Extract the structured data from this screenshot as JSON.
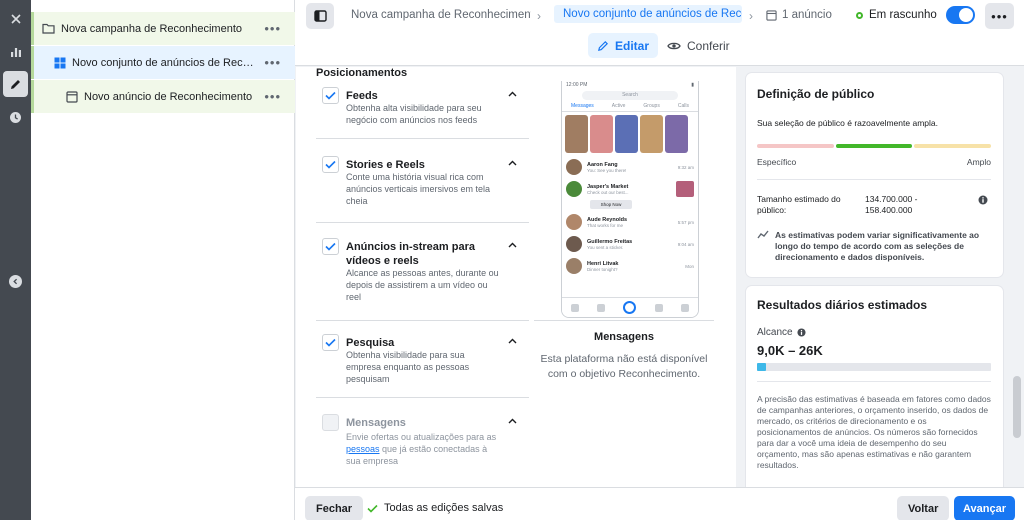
{
  "tree": {
    "campaign": "Nova campanha de Reconhecimento",
    "adset": "Novo conjunto de anúncios de Reconhecimento",
    "ad": "Novo anúncio de Reconhecimento",
    "more": "•••"
  },
  "topbar": {
    "crumb_campaign": "Nova campanha de Reconhecimento",
    "crumb_adset": "Novo conjunto de anúncios de Reconhecimento",
    "crumb_ad": "1 anúncio",
    "status": "Em rascunho",
    "more": "•••",
    "mode_edit": "Editar",
    "mode_review": "Conferir"
  },
  "placements": {
    "title": "Posicionamentos",
    "items": [
      {
        "name": "Feeds",
        "desc": "Obtenha alta visibilidade para seu negócio com anúncios nos feeds"
      },
      {
        "name": "Stories e Reels",
        "desc": "Conte uma história visual rica com anúncios verticais imersivos em tela cheia"
      },
      {
        "name": "Anúncios in-stream para vídeos e reels",
        "desc": "Alcance as pessoas antes, durante ou depois de assistirem a um vídeo ou reel"
      },
      {
        "name": "Pesquisa",
        "desc": "Obtenha visibilidade para sua empresa enquanto as pessoas pesquisam"
      },
      {
        "name": "Mensagens",
        "desc_pre": "Envie ofertas ou atualizações para as",
        "desc_link": "pessoas",
        "desc_post": "que já estão conectadas à sua empresa"
      }
    ]
  },
  "preview": {
    "status_time": "12:00 PM",
    "search": "Search",
    "tabs": [
      "Messages",
      "Active",
      "Groups",
      "Calls"
    ],
    "threads": [
      {
        "name": "Aaron Fang",
        "msg": "You: See you there!",
        "time": "9:32 am"
      },
      {
        "name": "Jasper's Market",
        "msg": "Check out our best...",
        "time": "Sponsored"
      },
      {
        "name": "Aude Reynolds",
        "msg": "That works for me",
        "time": "5:57 pm"
      },
      {
        "name": "Guillermo Freitas",
        "msg": "You sent a sticker.",
        "time": "9:04 am"
      },
      {
        "name": "Henri Litvak",
        "msg": "Dinner tonight?",
        "time": "Mon"
      }
    ],
    "shop_now": "Shop Now",
    "title": "Mensagens",
    "note": "Esta plataforma não está disponível com o objetivo Reconhecimento."
  },
  "audience": {
    "title": "Definição de público",
    "summary": "Sua seleção de público é razoavelmente ampla.",
    "specific": "Específico",
    "broad": "Amplo",
    "size_label": "Tamanho estimado do público:",
    "size_value": "134.700.000 - 158.400.000",
    "estimate_note": "As estimativas podem variar significativamente ao longo do tempo de acordo com as seleções de direcionamento e dados disponíveis."
  },
  "results": {
    "title": "Resultados diários estimados",
    "reach_label": "Alcance",
    "reach_value": "9,0K – 26K",
    "reach_fill_pct": 4,
    "note": "A precisão das estimativas é baseada em fatores como dados de campanhas anteriores, o orçamento inserido, os dados de mercado, os critérios de direcionamento e os posicionamentos de anúncios. Os números são fornecidos para dar a você uma ideia de desempenho do seu orçamento, mas são apenas estimativas e não garantem resultados."
  },
  "footer": {
    "close": "Fechar",
    "saved": "Todas as edições salvas",
    "back": "Voltar",
    "next": "Avançar"
  },
  "colors": {
    "accent": "#1877f2",
    "success": "#42b72a"
  }
}
